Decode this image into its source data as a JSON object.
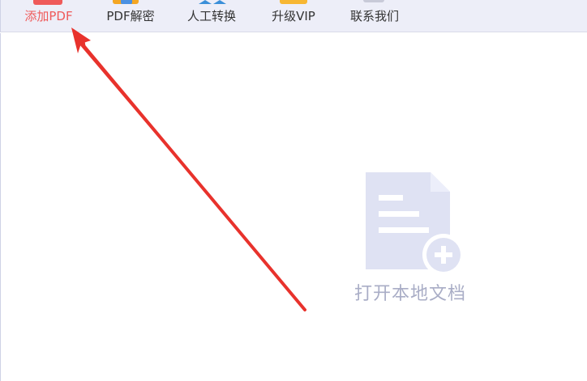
{
  "toolbar": {
    "items": [
      {
        "label": "添加PDF",
        "icon": "add-pdf-icon",
        "active": true
      },
      {
        "label": "PDF解密",
        "icon": "pdf-decrypt-icon",
        "active": false
      },
      {
        "label": "人工转换",
        "icon": "manual-convert-icon",
        "active": false
      },
      {
        "label": "升级VIP",
        "icon": "vip-icon",
        "active": false
      },
      {
        "label": "联系我们",
        "icon": "contact-icon",
        "active": false
      }
    ]
  },
  "main": {
    "empty_state": {
      "icon": "add-document-icon",
      "label": "打开本地文档"
    }
  },
  "annotation": {
    "arrow_color": "#e8322c",
    "points_to": "add-pdf-button"
  },
  "colors": {
    "active_text": "#ef5a5a",
    "toolbar_bg": "#edeef8",
    "empty_icon": "#dfe2f3",
    "empty_text": "#a9adc6"
  }
}
